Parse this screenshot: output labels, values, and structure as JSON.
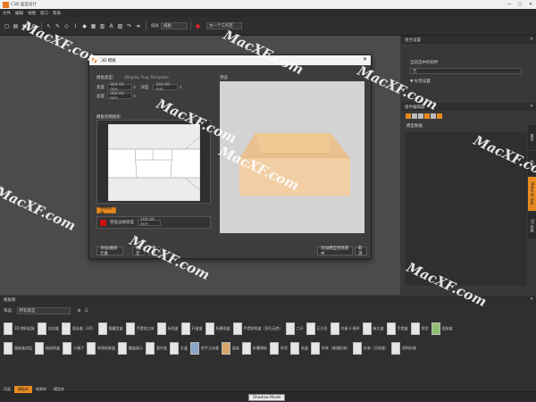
{
  "app": {
    "title": "C3D 盒型设计",
    "window_controls": [
      "—",
      "▢",
      "✕"
    ]
  },
  "menu": [
    "文件",
    "编辑",
    "视图",
    "窗口",
    "帮助"
  ],
  "toolbar": {
    "material_label": "纸张",
    "material_value": "纸板",
    "style_value": "文一个工作区"
  },
  "panels": {
    "props_title": "组合设置",
    "props_label": "当前选中的组件",
    "props_value": "无",
    "props_sub": "▼ 标签设置",
    "layers_title": "组件编辑器",
    "layers_sub": "模型数据"
  },
  "side_tabs": [
    "属性",
    "图层",
    "Material 材质",
    "3D 视图"
  ],
  "dialog": {
    "title": "C3D 模板",
    "template_label": "模板类型:",
    "template_value": "Display Tray Template",
    "width_label": "宽度",
    "width_value": "304.00 mm",
    "depth_label": "深度",
    "depth_value": "204.00 mm",
    "height_label": "高度",
    "height_value": "304.00 mm",
    "section_dieline": "模板装箱图形",
    "preview_title": "预览",
    "paper_button": "纸张选择",
    "paper_label": "厚纸边缘厚度",
    "paper_value": "100.00 mm",
    "btn_settings": "添加/删除元素",
    "btn_ok": "确定",
    "btn_reset": "重设",
    "btn_apply": "添加模型到场景中",
    "btn_cancel": "取消"
  },
  "library": {
    "title": "模板库",
    "filter_label": "筛选:",
    "filter_value": "所有类型",
    "row1": [
      "3D 物料层板",
      "自由盒",
      "瓶身盒（3D）",
      "管罐型盒",
      "手提袋立体",
      "折纸盒",
      "开窗盒",
      "折叠纸盒",
      "手提袋纸盒（双孔无底）",
      "二开",
      "正方形",
      "内嵌 4 格杯",
      "新方盒",
      "手提盒",
      "袋型",
      "组装盒"
    ],
    "row2": [
      "蛋糕盒双层",
      "抽屉纸盒",
      "小箱子",
      "转角组装盒",
      "翻盖展示",
      "管件盒",
      "礼盒",
      "把手立体盒",
      "展架",
      "折叠隔板",
      "杯型",
      "纸盒",
      "折装（普通折装）",
      "折装（天地盖）",
      "透明封装"
    ]
  },
  "bottom_tabs": [
    "页面",
    "模板库",
    "效果库",
    "模型库"
  ],
  "status": {
    "shadow_mode": "Shadow Mode"
  },
  "watermark": "MacXF.com",
  "colors": {
    "accent": "#e88b1f",
    "box": "#f1cea3",
    "box_side": "#e9c190",
    "preview_bg": "#d3d3d3",
    "swatch": "#d01010"
  }
}
